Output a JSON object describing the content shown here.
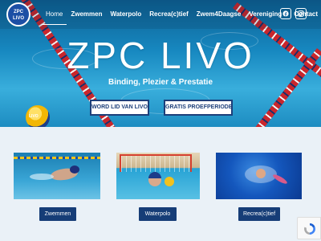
{
  "brand": {
    "logo_text": "ZPC LIVO",
    "logo_line1": "ZPC",
    "logo_line2": "LIVO"
  },
  "nav": {
    "items": [
      {
        "label": "Home"
      },
      {
        "label": "Zwemmen"
      },
      {
        "label": "Waterpolo"
      },
      {
        "label": "Recrea(c)tief"
      },
      {
        "label": "Zwem4Daagse"
      },
      {
        "label": "Vereniging"
      },
      {
        "label": "Contact"
      }
    ],
    "dropdown_icon": "chevron-down-icon"
  },
  "social": {
    "icons": [
      "facebook-icon",
      "instagram-icon"
    ]
  },
  "hero": {
    "title": "ZPC LIVO",
    "tagline": "Binding, Plezier & Prestatie",
    "buttons": [
      {
        "label": "WORD LID VAN LIVO"
      },
      {
        "label": "GRATIS PROEFPERIODE"
      }
    ],
    "ball_text": "LIVO"
  },
  "cards": [
    {
      "label": "Zwemmen"
    },
    {
      "label": "Waterpolo"
    },
    {
      "label": "Recrea(c)tief"
    }
  ],
  "colors": {
    "accent": "#163d77",
    "hero_water": "#1788c0",
    "lane_red": "#c9262c"
  },
  "recaptcha": {
    "icon": "recaptcha-icon"
  }
}
